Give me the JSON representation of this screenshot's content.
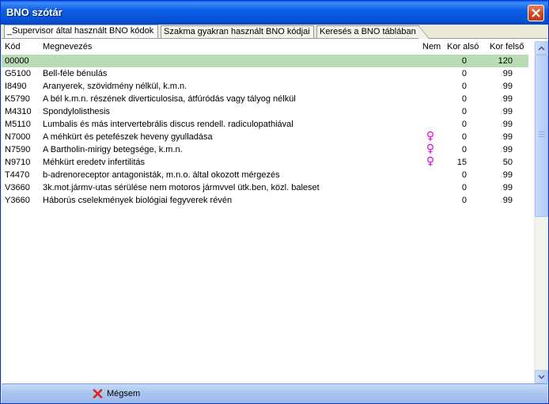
{
  "window": {
    "title": "BNO szótár"
  },
  "tabs": [
    {
      "label": "_Supervisor által használt BNO kódok",
      "active": true
    },
    {
      "label": "Szakma gyakran használt BNO kódjai",
      "active": false
    },
    {
      "label": "Keresés a BNO táblában",
      "active": false
    }
  ],
  "columns": {
    "code": "Kód",
    "name": "Megnevezés",
    "sex": "Nem",
    "age_min": "Kor alsó",
    "age_max": "Kor felső"
  },
  "rows": [
    {
      "code": "00000",
      "name": "",
      "sex": "",
      "age_min": "0",
      "age_max": "120",
      "selected": true
    },
    {
      "code": "G5100",
      "name": "Bell-féle bénulás",
      "sex": "",
      "age_min": "0",
      "age_max": "99"
    },
    {
      "code": "I8490",
      "name": "Aranyerek, szövidmény nélkül, k.m.n.",
      "sex": "",
      "age_min": "0",
      "age_max": "99"
    },
    {
      "code": "K5790",
      "name": "A bél k.m.n. részének diverticulosisa, átfúródás vagy tályog nélkül",
      "sex": "",
      "age_min": "0",
      "age_max": "99"
    },
    {
      "code": "M4310",
      "name": "Spondylolisthesis",
      "sex": "",
      "age_min": "0",
      "age_max": "99"
    },
    {
      "code": "M5110",
      "name": "Lumbalis és más intervertebrális discus rendell. radiculopathiával",
      "sex": "",
      "age_min": "0",
      "age_max": "99"
    },
    {
      "code": "N7000",
      "name": "A méhkürt és petefészek heveny gyulladása",
      "sex": "♀",
      "age_min": "0",
      "age_max": "99"
    },
    {
      "code": "N7590",
      "name": "A Bartholin-mirigy betegsége, k.m.n.",
      "sex": "♀",
      "age_min": "0",
      "age_max": "99"
    },
    {
      "code": "N9710",
      "name": "Méhkürt eredetv infertilitás",
      "sex": "♀",
      "age_min": "15",
      "age_max": "50"
    },
    {
      "code": "T4470",
      "name": "b-adrenoreceptor antagonisták, m.n.o. által okozott mérgezés",
      "sex": "",
      "age_min": "0",
      "age_max": "99"
    },
    {
      "code": "V3660",
      "name": "3k.mot.jármv-utas sérülése nem motoros jármvvel ütk.ben, közl. baleset",
      "sex": "",
      "age_min": "0",
      "age_max": "99"
    },
    {
      "code": "Y3660",
      "name": "Háborús cselekmények biológiai fegyverek révén",
      "sex": "",
      "age_min": "0",
      "age_max": "99"
    }
  ],
  "footer": {
    "cancel_label": "Mégsem"
  },
  "icons": {
    "close": "close-icon",
    "cancel": "red-x-icon",
    "female": "female-symbol-icon"
  },
  "colors": {
    "selected_row": "#b8dcb4",
    "female_symbol": "#e600e6",
    "titlebar": "#0655d8",
    "cancel_icon": "#e02020"
  }
}
